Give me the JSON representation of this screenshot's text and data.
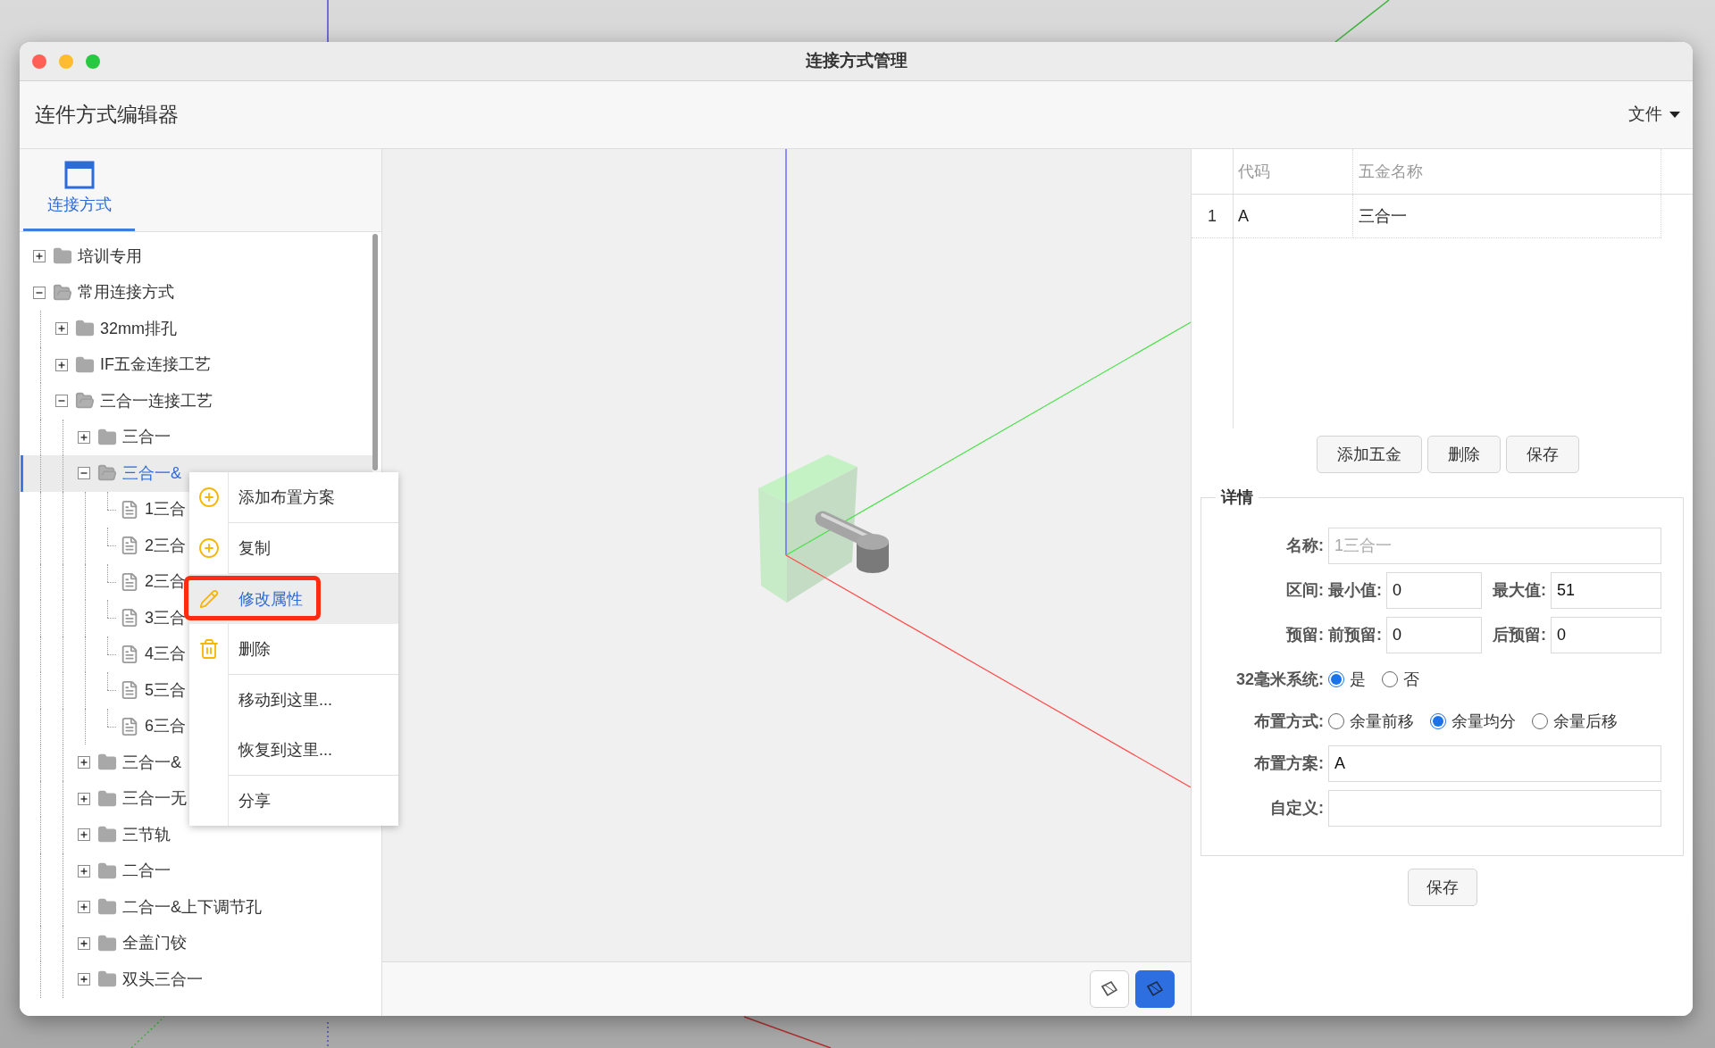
{
  "window": {
    "title": "连接方式管理"
  },
  "header": {
    "title": "连件方式编辑器",
    "menu": "文件"
  },
  "sidebar": {
    "tabs": [
      {
        "label": "连接方式",
        "selected": true
      }
    ],
    "tree": [
      {
        "label": "培训专用",
        "kind": "folder",
        "expanded": false,
        "selected": false
      },
      {
        "label": "常用连接方式",
        "kind": "folder",
        "expanded": true,
        "selected": false,
        "children": [
          {
            "label": "32mm排孔",
            "kind": "folder",
            "expanded": false,
            "selected": false
          },
          {
            "label": "IF五金连接工艺",
            "kind": "folder",
            "expanded": false,
            "selected": false
          },
          {
            "label": "三合一连接工艺",
            "kind": "folder",
            "expanded": true,
            "selected": false,
            "children": [
              {
                "label": "三合一",
                "kind": "folder",
                "expanded": false,
                "selected": false
              },
              {
                "label": "三合一&",
                "kind": "folder",
                "expanded": true,
                "selected": true,
                "children": [
                  {
                    "label": "1三合",
                    "kind": "file",
                    "selected": false
                  },
                  {
                    "label": "2三合",
                    "kind": "file",
                    "selected": false
                  },
                  {
                    "label": "2三合",
                    "kind": "file",
                    "selected": false
                  },
                  {
                    "label": "3三合",
                    "kind": "file",
                    "selected": false
                  },
                  {
                    "label": "4三合",
                    "kind": "file",
                    "selected": false
                  },
                  {
                    "label": "5三合",
                    "kind": "file",
                    "selected": false
                  },
                  {
                    "label": "6三合",
                    "kind": "file",
                    "selected": false
                  }
                ]
              },
              {
                "label": "三合一&",
                "kind": "folder",
                "expanded": false,
                "selected": false
              },
              {
                "label": "三合一无",
                "kind": "folder",
                "expanded": false,
                "selected": false
              },
              {
                "label": "三节轨",
                "kind": "folder",
                "expanded": false,
                "selected": false
              },
              {
                "label": "二合一",
                "kind": "folder",
                "expanded": false,
                "selected": false
              },
              {
                "label": "二合一&上下调节孔",
                "kind": "folder",
                "expanded": false,
                "selected": false
              },
              {
                "label": "全盖门铰",
                "kind": "folder",
                "expanded": false,
                "selected": false
              },
              {
                "label": "双头三合一",
                "kind": "folder",
                "expanded": false,
                "selected": false
              }
            ]
          }
        ]
      }
    ]
  },
  "context_menu": {
    "groups": [
      [
        {
          "label": "添加布置方案",
          "kind": "add",
          "selected": false,
          "outlined": false
        }
      ],
      [
        {
          "label": "复制",
          "kind": "add",
          "selected": false,
          "outlined": false
        }
      ],
      [
        {
          "label": "修改属性",
          "kind": "edit",
          "selected": true,
          "outlined": true
        },
        {
          "label": "删除",
          "kind": "delete",
          "selected": false,
          "outlined": false
        }
      ],
      [
        {
          "label": "移动到这里...",
          "kind": "plain",
          "selected": false,
          "outlined": false
        },
        {
          "label": "恢复到这里...",
          "kind": "plain",
          "selected": false,
          "outlined": false
        }
      ],
      [
        {
          "label": "分享",
          "kind": "plain",
          "selected": false,
          "outlined": false
        }
      ]
    ]
  },
  "viewport": {
    "view_buttons": [
      {
        "selected": false
      },
      {
        "selected": true
      }
    ]
  },
  "hardware_table": {
    "columns": [
      "代码",
      "五金名称"
    ],
    "rows": [
      {
        "index": "1",
        "cells": [
          "A",
          "三合一"
        ]
      }
    ]
  },
  "table_buttons": [
    "添加五金",
    "删除",
    "保存"
  ],
  "details": {
    "legend": "详情",
    "name": {
      "label": "名称:",
      "placeholder": "1三合一"
    },
    "range": {
      "label": "区间:",
      "min_label": "最小值:",
      "min": "0",
      "max_label": "最大值:",
      "max": "51"
    },
    "reserve": {
      "label": "预留:",
      "front_label": "前预留:",
      "front": "0",
      "back_label": "后预留:",
      "back": "0"
    },
    "system32": {
      "label": "32毫米系统:",
      "options": [
        {
          "label": "是",
          "selected": true
        },
        {
          "label": "否",
          "selected": false
        }
      ]
    },
    "layout_mode": {
      "label": "布置方式:",
      "options": [
        {
          "label": "余量前移",
          "selected": false
        },
        {
          "label": "余量均分",
          "selected": true
        },
        {
          "label": "余量后移",
          "selected": false
        }
      ]
    },
    "scheme": {
      "label": "布置方案:",
      "value": "A"
    },
    "custom": {
      "label": "自定义:"
    }
  },
  "save_button": "保存"
}
